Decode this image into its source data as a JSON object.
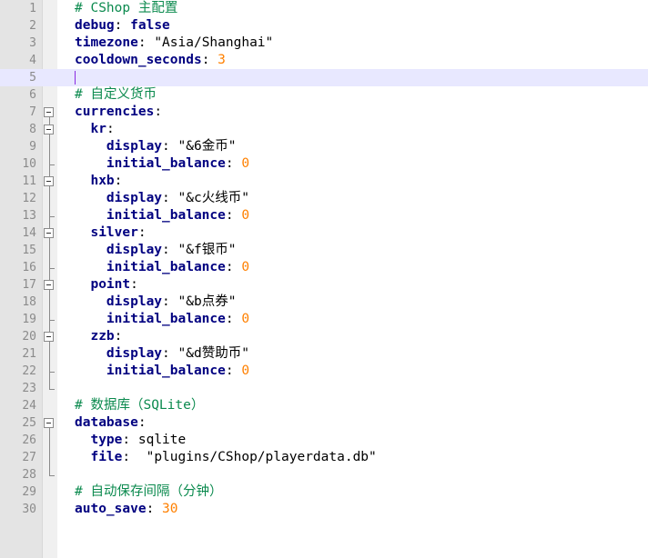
{
  "editor": {
    "language": "yaml",
    "current_line": 5,
    "folds": [
      {
        "start": 7,
        "end": 23
      },
      {
        "start": 8,
        "end": 10
      },
      {
        "start": 11,
        "end": 13
      },
      {
        "start": 14,
        "end": 16
      },
      {
        "start": 17,
        "end": 19
      },
      {
        "start": 20,
        "end": 22
      },
      {
        "start": 25,
        "end": 28
      }
    ],
    "colors": {
      "comment": "#0b8a4e",
      "key": "#000080",
      "number": "#ff8000",
      "current_line_bg": "#e8e8ff",
      "gutter_bg": "#e4e4e4"
    },
    "lines": [
      {
        "n": "1",
        "indent": "",
        "tokens": [
          {
            "t": "comment",
            "v": "# CShop 主配置"
          }
        ]
      },
      {
        "n": "2",
        "indent": "",
        "tokens": [
          {
            "t": "key",
            "v": "debug"
          },
          {
            "t": "punct",
            "v": ": "
          },
          {
            "t": "bool",
            "v": "false"
          }
        ]
      },
      {
        "n": "3",
        "indent": "",
        "tokens": [
          {
            "t": "key",
            "v": "timezone"
          },
          {
            "t": "punct",
            "v": ": "
          },
          {
            "t": "string",
            "v": "\"Asia/Shanghai\""
          }
        ]
      },
      {
        "n": "4",
        "indent": "",
        "tokens": [
          {
            "t": "key",
            "v": "cooldown_seconds"
          },
          {
            "t": "punct",
            "v": ": "
          },
          {
            "t": "num",
            "v": "3"
          }
        ]
      },
      {
        "n": "5",
        "indent": "",
        "tokens": []
      },
      {
        "n": "6",
        "indent": "",
        "tokens": [
          {
            "t": "comment",
            "v": "# 自定义货币"
          }
        ]
      },
      {
        "n": "7",
        "indent": "",
        "tokens": [
          {
            "t": "key",
            "v": "currencies"
          },
          {
            "t": "punct",
            "v": ":"
          }
        ]
      },
      {
        "n": "8",
        "indent": "  ",
        "tokens": [
          {
            "t": "key",
            "v": "kr"
          },
          {
            "t": "punct",
            "v": ":"
          }
        ]
      },
      {
        "n": "9",
        "indent": "    ",
        "tokens": [
          {
            "t": "key",
            "v": "display"
          },
          {
            "t": "punct",
            "v": ": "
          },
          {
            "t": "string",
            "v": "\"&6金币\""
          }
        ]
      },
      {
        "n": "10",
        "indent": "    ",
        "tokens": [
          {
            "t": "key",
            "v": "initial_balance"
          },
          {
            "t": "punct",
            "v": ": "
          },
          {
            "t": "num",
            "v": "0"
          }
        ]
      },
      {
        "n": "11",
        "indent": "  ",
        "tokens": [
          {
            "t": "key",
            "v": "hxb"
          },
          {
            "t": "punct",
            "v": ":"
          }
        ]
      },
      {
        "n": "12",
        "indent": "    ",
        "tokens": [
          {
            "t": "key",
            "v": "display"
          },
          {
            "t": "punct",
            "v": ": "
          },
          {
            "t": "string",
            "v": "\"&c火线币\""
          }
        ]
      },
      {
        "n": "13",
        "indent": "    ",
        "tokens": [
          {
            "t": "key",
            "v": "initial_balance"
          },
          {
            "t": "punct",
            "v": ": "
          },
          {
            "t": "num",
            "v": "0"
          }
        ]
      },
      {
        "n": "14",
        "indent": "  ",
        "tokens": [
          {
            "t": "key",
            "v": "silver"
          },
          {
            "t": "punct",
            "v": ":"
          }
        ]
      },
      {
        "n": "15",
        "indent": "    ",
        "tokens": [
          {
            "t": "key",
            "v": "display"
          },
          {
            "t": "punct",
            "v": ": "
          },
          {
            "t": "string",
            "v": "\"&f银币\""
          }
        ]
      },
      {
        "n": "16",
        "indent": "    ",
        "tokens": [
          {
            "t": "key",
            "v": "initial_balance"
          },
          {
            "t": "punct",
            "v": ": "
          },
          {
            "t": "num",
            "v": "0"
          }
        ]
      },
      {
        "n": "17",
        "indent": "  ",
        "tokens": [
          {
            "t": "key",
            "v": "point"
          },
          {
            "t": "punct",
            "v": ":"
          }
        ]
      },
      {
        "n": "18",
        "indent": "    ",
        "tokens": [
          {
            "t": "key",
            "v": "display"
          },
          {
            "t": "punct",
            "v": ": "
          },
          {
            "t": "string",
            "v": "\"&b点券\""
          }
        ]
      },
      {
        "n": "19",
        "indent": "    ",
        "tokens": [
          {
            "t": "key",
            "v": "initial_balance"
          },
          {
            "t": "punct",
            "v": ": "
          },
          {
            "t": "num",
            "v": "0"
          }
        ]
      },
      {
        "n": "20",
        "indent": "  ",
        "tokens": [
          {
            "t": "key",
            "v": "zzb"
          },
          {
            "t": "punct",
            "v": ":"
          }
        ]
      },
      {
        "n": "21",
        "indent": "    ",
        "tokens": [
          {
            "t": "key",
            "v": "display"
          },
          {
            "t": "punct",
            "v": ": "
          },
          {
            "t": "string",
            "v": "\"&d赞助币\""
          }
        ]
      },
      {
        "n": "22",
        "indent": "    ",
        "tokens": [
          {
            "t": "key",
            "v": "initial_balance"
          },
          {
            "t": "punct",
            "v": ": "
          },
          {
            "t": "num",
            "v": "0"
          }
        ]
      },
      {
        "n": "23",
        "indent": "",
        "tokens": []
      },
      {
        "n": "24",
        "indent": "",
        "tokens": [
          {
            "t": "comment",
            "v": "# 数据库（SQLite）"
          }
        ]
      },
      {
        "n": "25",
        "indent": "",
        "tokens": [
          {
            "t": "key",
            "v": "database"
          },
          {
            "t": "punct",
            "v": ":"
          }
        ]
      },
      {
        "n": "26",
        "indent": "  ",
        "tokens": [
          {
            "t": "key",
            "v": "type"
          },
          {
            "t": "punct",
            "v": ": "
          },
          {
            "t": "plain",
            "v": "sqlite"
          }
        ]
      },
      {
        "n": "27",
        "indent": "  ",
        "tokens": [
          {
            "t": "key",
            "v": "file"
          },
          {
            "t": "punct",
            "v": ":  "
          },
          {
            "t": "string",
            "v": "\"plugins/CShop/playerdata.db\""
          }
        ]
      },
      {
        "n": "28",
        "indent": "",
        "tokens": []
      },
      {
        "n": "29",
        "indent": "",
        "tokens": [
          {
            "t": "comment",
            "v": "# 自动保存间隔（分钟）"
          }
        ]
      },
      {
        "n": "30",
        "indent": "",
        "tokens": [
          {
            "t": "key",
            "v": "auto_save"
          },
          {
            "t": "punct",
            "v": ": "
          },
          {
            "t": "num",
            "v": "30"
          }
        ]
      }
    ]
  }
}
